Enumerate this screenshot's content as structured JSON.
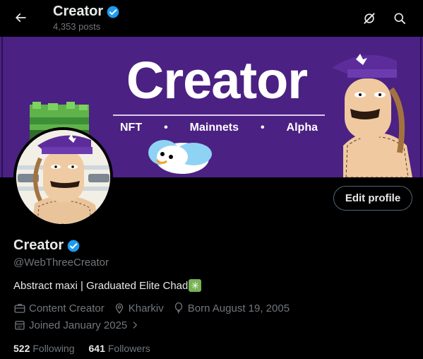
{
  "header": {
    "title": "Creator",
    "posts": "4,353 posts"
  },
  "banner": {
    "title": "Creator",
    "tags": [
      "NFT",
      "Mainnets",
      "Alpha"
    ],
    "separator": "•"
  },
  "actions": {
    "edit_profile": "Edit profile"
  },
  "profile": {
    "name": "Creator",
    "handle": "@WebThreeCreator",
    "bio": "Abstract maxi | Graduated Elite Chad",
    "category": "Content Creator",
    "location": "Kharkiv",
    "born": "Born August 19, 2005",
    "joined": "Joined January 2025"
  },
  "stats": {
    "following_count": "522",
    "following_label": "Following",
    "followers_count": "641",
    "followers_label": "Followers"
  },
  "icons": {
    "back": "arrow-left-icon",
    "grok": "grok-icon",
    "search": "search-icon",
    "verified": "verified-badge-icon",
    "category": "briefcase-icon",
    "location": "location-pin-icon",
    "born": "balloon-icon",
    "joined": "calendar-icon",
    "sparkle": "sparkle-emoji"
  },
  "colors": {
    "background": "#000000",
    "banner": "#4b2183",
    "verified": "#1d9bf0",
    "muted_text": "#71767b",
    "primary_text": "#e7e9ea"
  }
}
